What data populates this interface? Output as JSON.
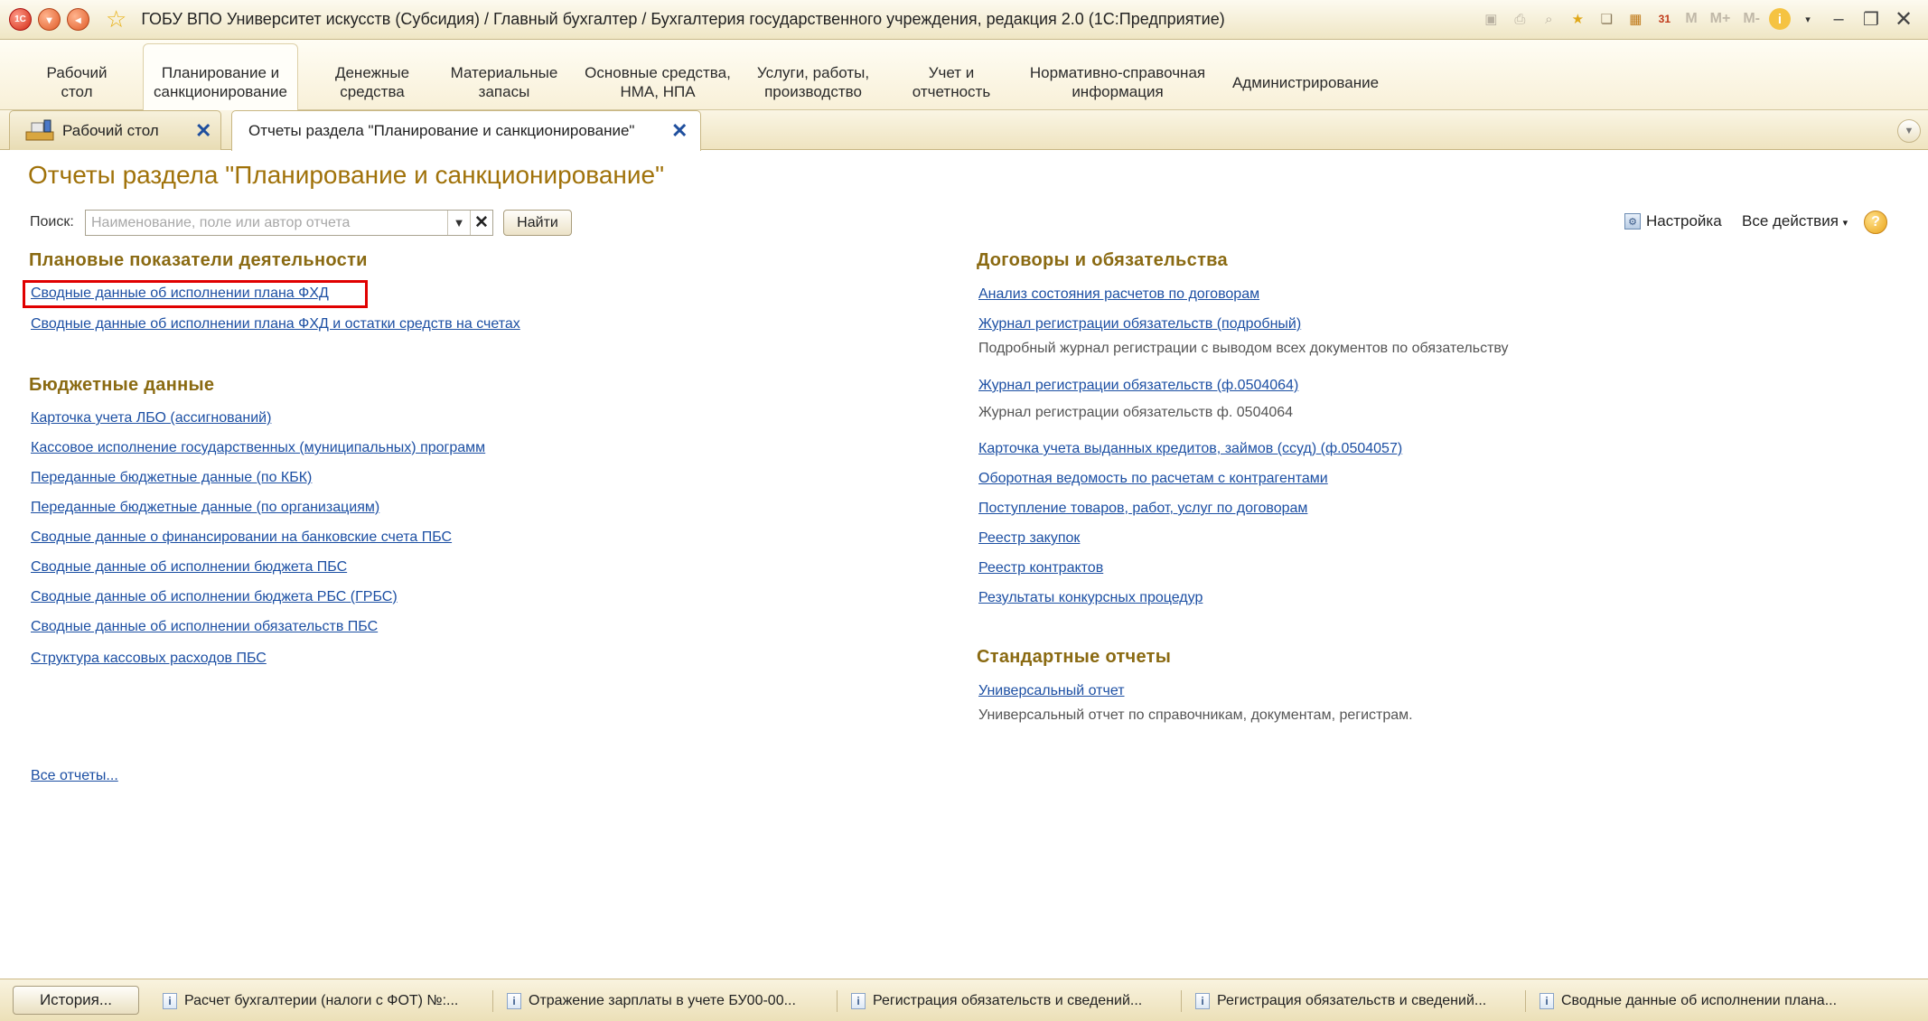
{
  "window": {
    "title": "ГОБУ ВПО Университет искусств (Субсидия) / Главный бухгалтер / Бухгалтерия государственного учреждения, редакция 2.0  (1С:Предприятие)",
    "logo_text": "1С"
  },
  "toolbar_right": {
    "m": "M",
    "m_plus": "M+",
    "m_minus": "M-",
    "calendar": "31"
  },
  "sections": [
    {
      "label": "Рабочий стол"
    },
    {
      "label": "Планирование и санкционирование"
    },
    {
      "label": "Денежные средства"
    },
    {
      "label": "Материальные запасы"
    },
    {
      "label": "Основные средства, НМА, НПА"
    },
    {
      "label": "Услуги, работы, производство"
    },
    {
      "label": "Учет и отчетность"
    },
    {
      "label": "Нормативно-справочная информация"
    },
    {
      "label": "Администрирование"
    }
  ],
  "tabs": [
    {
      "label": "Рабочий стол"
    },
    {
      "label": "Отчеты раздела \"Планирование и санкционирование\""
    }
  ],
  "page": {
    "title": "Отчеты раздела \"Планирование и санкционирование\""
  },
  "search": {
    "label": "Поиск:",
    "placeholder": "Наименование, поле или автор отчета",
    "value": "",
    "find_button": "Найти"
  },
  "commands": {
    "settings": "Настройка",
    "all_actions": "Все действия",
    "help": "?"
  },
  "left_groups": [
    {
      "title": "Плановые показатели деятельности",
      "links": [
        "Сводные данные об исполнении плана ФХД",
        "Сводные данные об исполнении плана ФХД и остатки средств на счетах"
      ]
    },
    {
      "title": "Бюджетные данные",
      "links": [
        "Карточка учета ЛБО (ассигнований)",
        "Кассовое исполнение государственных (муниципальных) программ",
        "Переданные бюджетные данные (по КБК)",
        "Переданные бюджетные данные (по организациям)",
        "Сводные данные о финансировании на банковские счета ПБС",
        "Сводные данные об исполнении бюджета ПБС",
        "Сводные данные об исполнении бюджета РБС (ГРБС)",
        "Сводные данные об исполнении обязательств ПБС",
        "Структура кассовых расходов ПБС"
      ]
    }
  ],
  "right_groups": [
    {
      "title": "Договоры и обязательства",
      "links": [
        "Анализ состояния расчетов по договорам",
        "Журнал регистрации обязательств (подробный)",
        "Журнал регистрации обязательств (ф.0504064)",
        "Карточка учета выданных кредитов, займов (ссуд) (ф.0504057)",
        "Оборотная ведомость по расчетам с контрагентами",
        "Поступление товаров, работ, услуг по договорам",
        "Реестр закупок",
        "Реестр контрактов",
        "Результаты конкурсных процедур"
      ],
      "descriptions": [
        "Подробный журнал регистрации с выводом всех документов по обязательству",
        "Журнал регистрации обязательств ф. 0504064"
      ]
    },
    {
      "title": "Стандартные отчеты",
      "links": [
        "Универсальный отчет"
      ],
      "descriptions": [
        "Универсальный отчет по справочникам, документам, регистрам."
      ]
    }
  ],
  "all_reports_link": "Все отчеты...",
  "history": {
    "button": "История...",
    "items": [
      "Расчет бухгалтерии (налоги с ФОТ) №:...",
      "Отражение зарплаты в учете БУ00-00...",
      "Регистрация обязательств и сведений...",
      "Регистрация обязательств и сведений...",
      "Сводные данные об исполнении плана..."
    ]
  },
  "colors": {
    "title_color": "#a0720a",
    "group_heading": "#8a6a12",
    "link": "#1c4fa3",
    "highlight": "#e00000"
  }
}
